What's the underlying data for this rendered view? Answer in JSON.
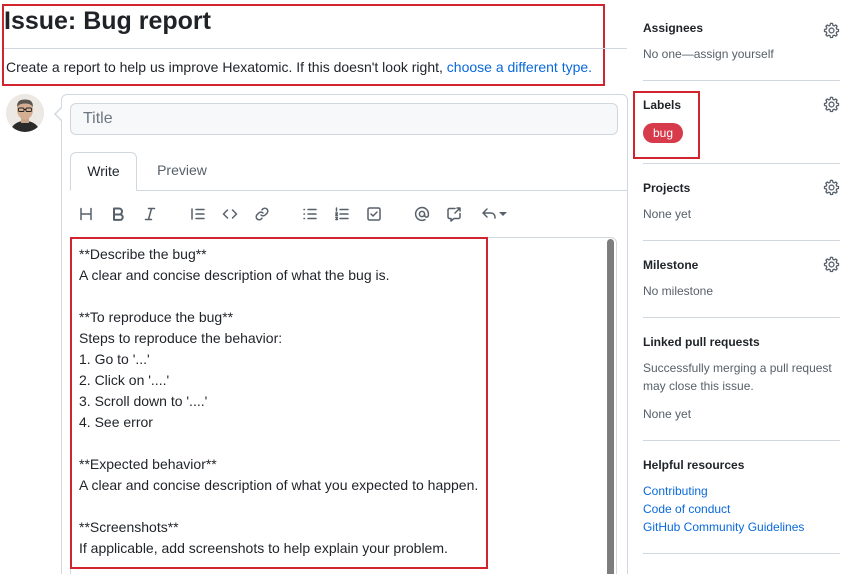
{
  "header": {
    "title": "Issue: Bug report",
    "description": "Create a report to help us improve Hexatomic. If this doesn't look right, ",
    "link_text": "choose a different type."
  },
  "composer": {
    "title_placeholder": "Title",
    "tabs": [
      {
        "label": "Write",
        "active": true
      },
      {
        "label": "Preview",
        "active": false
      }
    ],
    "toolbar": [
      {
        "icon": "heading-icon"
      },
      {
        "icon": "bold-icon"
      },
      {
        "icon": "italic-icon"
      },
      {
        "icon": "quote-icon"
      },
      {
        "icon": "code-icon"
      },
      {
        "icon": "link-icon"
      },
      {
        "icon": "unordered-list-icon"
      },
      {
        "icon": "ordered-list-icon"
      },
      {
        "icon": "task-list-icon"
      },
      {
        "icon": "mention-icon"
      },
      {
        "icon": "reference-icon"
      },
      {
        "icon": "reply-icon"
      }
    ],
    "body": "**Describe the bug**\nA clear and concise description of what the bug is.\n\n**To reproduce the bug**\nSteps to reproduce the behavior:\n1. Go to '...'\n2. Click on '....'\n3. Scroll down to '....'\n4. See error\n\n**Expected behavior**\nA clear and concise description of what you expected to happen.\n\n**Screenshots**\nIf applicable, add screenshots to help explain your problem."
  },
  "sidebar": {
    "assignees": {
      "title": "Assignees",
      "value": "No one—assign yourself"
    },
    "labels": {
      "title": "Labels",
      "items": [
        {
          "name": "bug",
          "color": "#d73a4a"
        }
      ]
    },
    "projects": {
      "title": "Projects",
      "value": "None yet"
    },
    "milestone": {
      "title": "Milestone",
      "value": "No milestone"
    },
    "linked_prs": {
      "title": "Linked pull requests",
      "description": "Successfully merging a pull request may close this issue.",
      "value": "None yet"
    },
    "resources": {
      "title": "Helpful resources",
      "links": [
        "Contributing",
        "Code of conduct",
        "GitHub Community Guidelines"
      ]
    }
  },
  "colors": {
    "highlight": "#d1242f",
    "link": "#0969da",
    "bug_label": "#d73a4a"
  }
}
